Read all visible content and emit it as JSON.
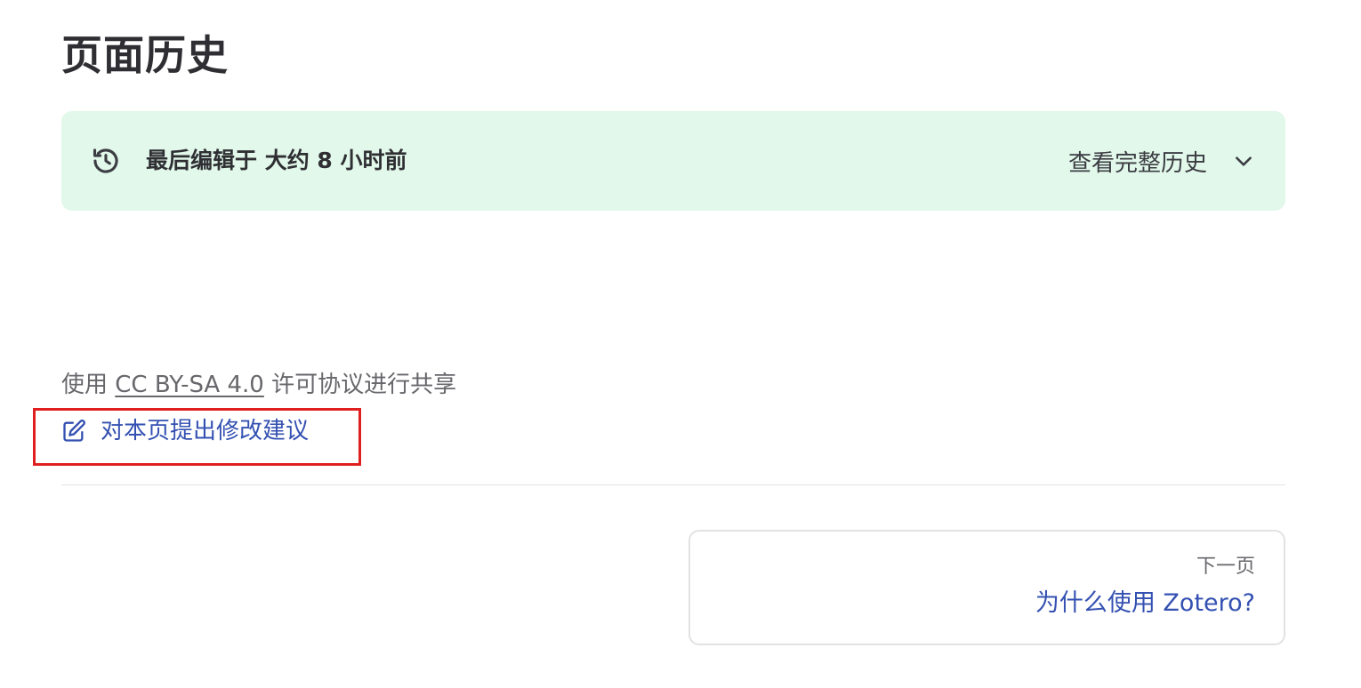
{
  "page": {
    "title": "页面历史"
  },
  "history": {
    "icon": "history-icon",
    "last_edited": "最后编辑于 大约 8 小时前",
    "view_full_label": "查看完整历史",
    "toggle_icon": "chevron-down-icon",
    "background_color": "#e1f8ea"
  },
  "footer": {
    "license_prefix": "使用",
    "license_link": "CC BY-SA 4.0",
    "license_suffix": "许可协议进行共享",
    "edit_icon": "edit-icon",
    "edit_label": "对本页提出修改建议",
    "link_color": "#3451b2",
    "highlight_color": "#e02020"
  },
  "pager": {
    "next_desc": "下一页",
    "next_title": "为什么使用 Zotero?"
  }
}
